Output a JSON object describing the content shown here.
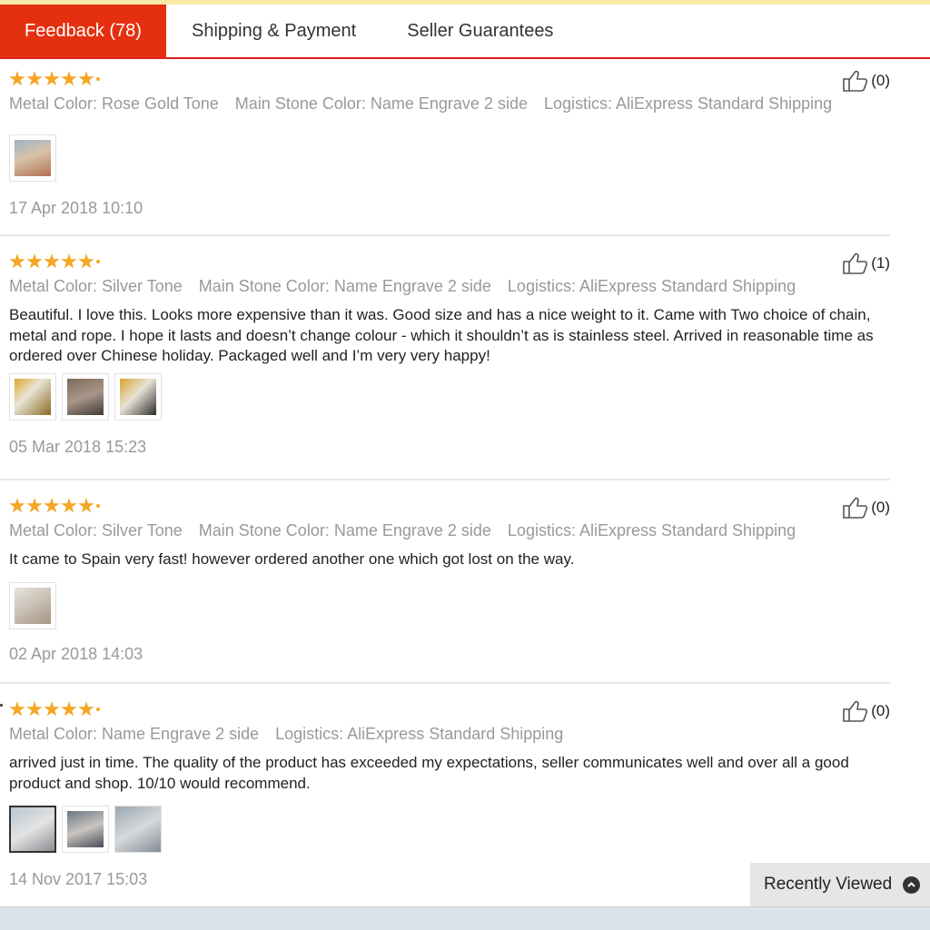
{
  "tabs": [
    {
      "label": "Feedback (78)",
      "active": true
    },
    {
      "label": "Shipping & Payment",
      "active": false
    },
    {
      "label": "Seller Guarantees",
      "active": false
    }
  ],
  "reviews": [
    {
      "rating": 5,
      "attributes": [
        "Metal Color: Rose Gold Tone",
        "Main Stone Color: Name Engrave 2 side",
        "Logistics: AliExpress Standard Shipping"
      ],
      "text": "",
      "useful_count": "(0)",
      "photos": [
        "photo-thumbnail"
      ],
      "date": "17 Apr 2018 10:10"
    },
    {
      "rating": 5,
      "attributes": [
        "Metal Color: Silver Tone",
        "Main Stone Color: Name Engrave 2 side",
        "Logistics: AliExpress Standard Shipping"
      ],
      "text": "Beautiful. I love this. Looks more expensive than it was. Good size and has a nice weight to it. Came with Two choice of chain, metal and rope. I hope it lasts and doesn’t change colour - which it shouldn’t as is stainless steel. Arrived in reasonable time as ordered over Chinese holiday. Packaged well and I’m very very happy!",
      "useful_count": "(1)",
      "photos": [
        "photo-thumbnail",
        "photo-thumbnail",
        "photo-thumbnail"
      ],
      "date": "05 Mar 2018 15:23"
    },
    {
      "rating": 5,
      "attributes": [
        "Metal Color: Silver Tone",
        "Main Stone Color: Name Engrave 2 side",
        "Logistics: AliExpress Standard Shipping"
      ],
      "text": "It came to Spain very fast! however ordered another one which got lost on the way.",
      "useful_count": "(0)",
      "photos": [
        "photo-thumbnail"
      ],
      "date": "02 Apr 2018 14:03"
    },
    {
      "rating": 5,
      "attributes": [
        "Metal Color: Name Engrave 2 side",
        "Logistics: AliExpress Standard Shipping"
      ],
      "text": "arrived just in time. The quality of the product has exceeded my expectations, seller communicates well and over all a good product and shop. 10/10 would recommend.",
      "useful_count": "(0)",
      "photos": [
        "photo-thumbnail",
        "photo-thumbnail",
        "photo-thumbnail"
      ],
      "date": "14 Nov 2017 15:03"
    }
  ],
  "recently_viewed": {
    "label": "Recently Viewed",
    "icon": "chevron-up-icon"
  },
  "colors": {
    "accent": "#e5300f",
    "star": "#f5a623",
    "muted_text": "#999999"
  }
}
